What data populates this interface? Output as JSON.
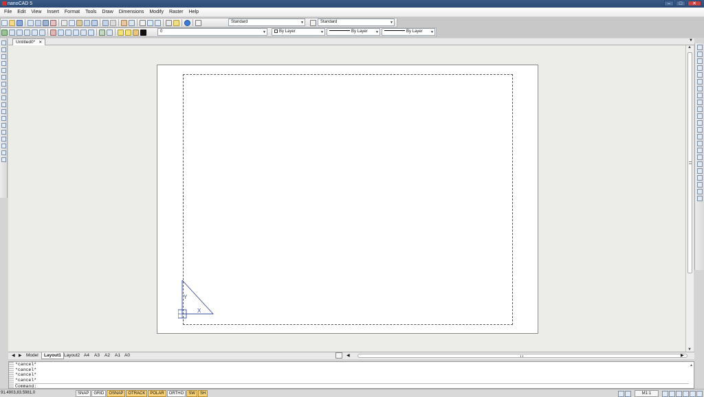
{
  "app": {
    "title": "nanoCAD 5"
  },
  "menu": [
    "File",
    "Edit",
    "View",
    "Insert",
    "Format",
    "Tools",
    "Draw",
    "Dimensions",
    "Modify",
    "Raster",
    "Help"
  ],
  "toolbar": {
    "text_style": "Standard",
    "dim_style": "Standard",
    "layer": "0",
    "color": "By Layer",
    "linetype": "By Layer",
    "lineweight": "By Layer"
  },
  "document": {
    "tab_label": "Untitled0*"
  },
  "ucs": {
    "y_label": "Y",
    "x_label": "X"
  },
  "layout_tabs": [
    "Model",
    "Layout1",
    "Layout2",
    "A4",
    "A3",
    "A2",
    "A1",
    "A0"
  ],
  "active_layout": "Layout1",
  "command": {
    "history": [
      "*cancel*",
      "*cancel*",
      "*cancel*",
      "*cancel*"
    ],
    "prompt": "Command:"
  },
  "status": {
    "coords": "91.4903,83.5981,0",
    "modes": [
      {
        "label": "SNAP",
        "on": false
      },
      {
        "label": "GRID",
        "on": false
      },
      {
        "label": "OSNAP",
        "on": true
      },
      {
        "label": "OTRACK",
        "on": true
      },
      {
        "label": "POLAR",
        "on": true
      },
      {
        "label": "ORTHO",
        "on": false
      },
      {
        "label": "SW",
        "on": true
      },
      {
        "label": "SH",
        "on": true
      }
    ],
    "scale": "M1:1"
  },
  "colors": {
    "titlebar": "#2c4a74",
    "mode_on": "#f7d27c",
    "ucs": "#3a4aa0"
  }
}
